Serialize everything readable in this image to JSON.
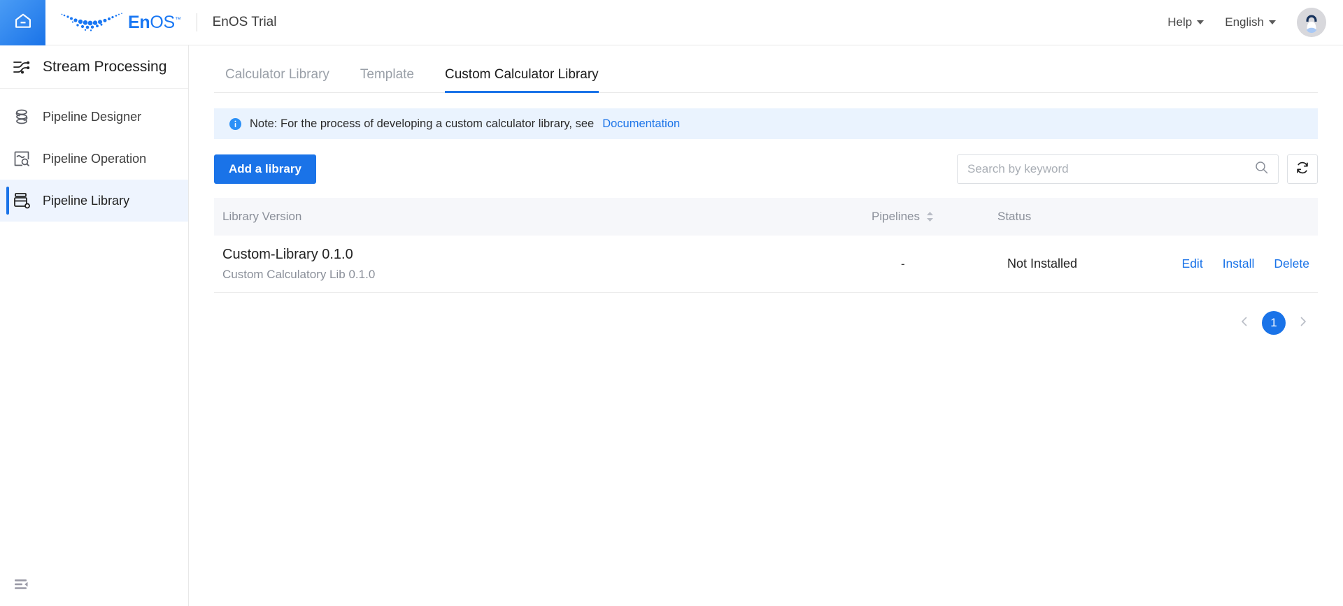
{
  "header": {
    "home_icon": "home-icon",
    "logo_mark": "enos-dots-logo",
    "logo_text_en": "En",
    "logo_text_os": "OS",
    "logo_tm": "™",
    "tenant": "EnOS Trial",
    "help_label": "Help",
    "language_label": "English",
    "avatar": "user-avatar"
  },
  "sidebar": {
    "section_title": "Stream Processing",
    "section_icon": "stream-processing-icon",
    "items": [
      {
        "label": "Pipeline Designer",
        "icon": "pipeline-designer-icon",
        "active": false
      },
      {
        "label": "Pipeline Operation",
        "icon": "pipeline-operation-icon",
        "active": false
      },
      {
        "label": "Pipeline Library",
        "icon": "pipeline-library-icon",
        "active": true
      }
    ],
    "collapse_icon": "collapse-sidebar-icon"
  },
  "tabs": [
    {
      "label": "Calculator Library",
      "active": false
    },
    {
      "label": "Template",
      "active": false
    },
    {
      "label": "Custom Calculator Library",
      "active": true
    }
  ],
  "note": {
    "icon": "info-icon",
    "text": "Note: For the process of developing a custom calculator library, see",
    "link_label": "Documentation"
  },
  "toolbar": {
    "add_library_label": "Add a library",
    "search_placeholder": "Search by keyword",
    "search_value": "",
    "search_icon": "search-icon",
    "refresh_icon": "refresh-icon"
  },
  "table": {
    "columns": [
      {
        "key": "version",
        "label": "Library Version",
        "sortable": false
      },
      {
        "key": "pipelines",
        "label": "Pipelines",
        "sortable": true
      },
      {
        "key": "status",
        "label": "Status",
        "sortable": false
      },
      {
        "key": "actions",
        "label": "",
        "sortable": false
      }
    ],
    "rows": [
      {
        "version_title": "Custom-Library 0.1.0",
        "version_desc": "Custom Calculatory Lib 0.1.0",
        "pipelines": "-",
        "status": "Not Installed",
        "actions": [
          "Edit",
          "Install",
          "Delete"
        ]
      }
    ]
  },
  "pagination": {
    "prev_icon": "chevron-left-icon",
    "next_icon": "chevron-right-icon",
    "current_page": "1"
  },
  "colors": {
    "accent": "#1a73e8",
    "note_bg": "#eaf3fe",
    "header_bg": "#f6f7fa",
    "muted_text": "#8a8f99"
  }
}
